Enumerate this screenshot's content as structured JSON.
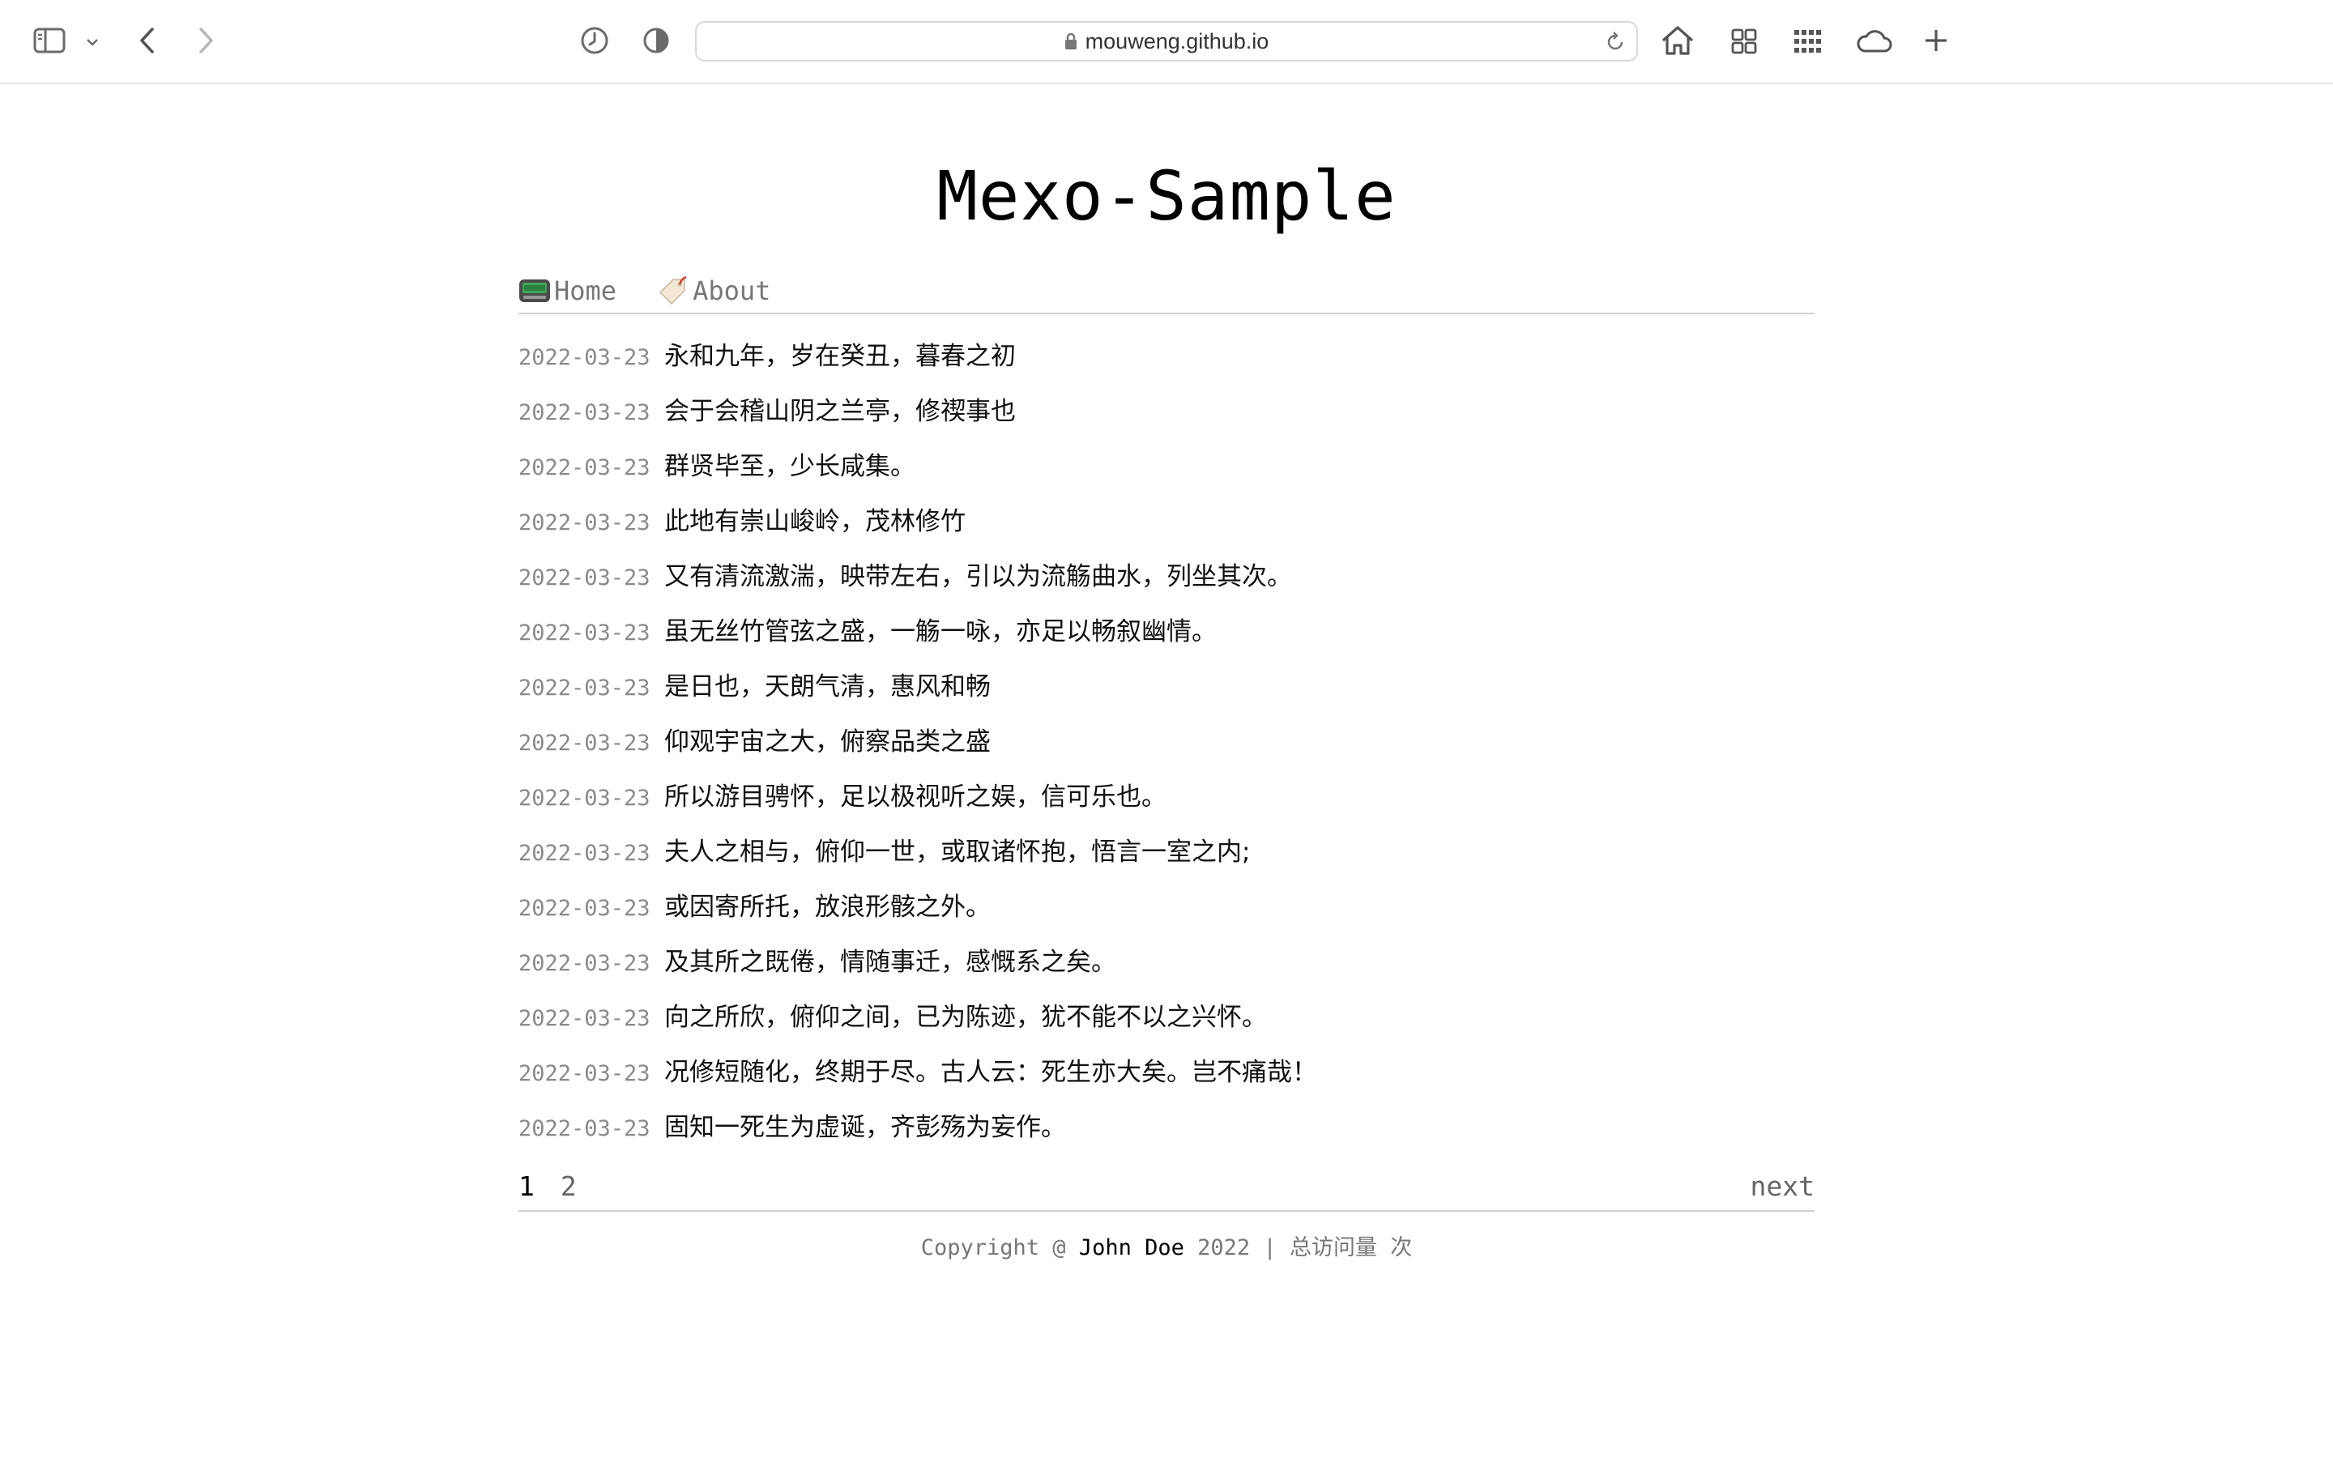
{
  "browser": {
    "url": "mouweng.github.io",
    "icons": [
      "sidebar-icon",
      "chevron-down-icon",
      "back-icon",
      "forward-icon",
      "history-icon",
      "privacy-shield-icon",
      "lock-icon",
      "reload-icon",
      "home-icon",
      "tab-overview-icon",
      "grid-icon",
      "cloud-icon",
      "plus-icon"
    ]
  },
  "site": {
    "title": "Mexo-Sample"
  },
  "nav": [
    {
      "label": "Home",
      "icon": "pager-icon"
    },
    {
      "label": "About",
      "icon": "tag-icon"
    }
  ],
  "posts": [
    {
      "date": "2022-03-23",
      "title": "永和九年，岁在癸丑，暮春之初"
    },
    {
      "date": "2022-03-23",
      "title": "会于会稽山阴之兰亭，修禊事也"
    },
    {
      "date": "2022-03-23",
      "title": "群贤毕至，少长咸集。"
    },
    {
      "date": "2022-03-23",
      "title": "此地有崇山峻岭，茂林修竹"
    },
    {
      "date": "2022-03-23",
      "title": "又有清流激湍，映带左右，引以为流觞曲水，列坐其次。"
    },
    {
      "date": "2022-03-23",
      "title": "虽无丝竹管弦之盛，一觞一咏，亦足以畅叙幽情。"
    },
    {
      "date": "2022-03-23",
      "title": "是日也，天朗气清，惠风和畅"
    },
    {
      "date": "2022-03-23",
      "title": "仰观宇宙之大，俯察品类之盛"
    },
    {
      "date": "2022-03-23",
      "title": "所以游目骋怀，足以极视听之娱，信可乐也。"
    },
    {
      "date": "2022-03-23",
      "title": "夫人之相与，俯仰一世，或取诸怀抱，悟言一室之内;"
    },
    {
      "date": "2022-03-23",
      "title": "或因寄所托，放浪形骸之外。"
    },
    {
      "date": "2022-03-23",
      "title": "及其所之既倦，情随事迁，感慨系之矣。"
    },
    {
      "date": "2022-03-23",
      "title": "向之所欣，俯仰之间，已为陈迹，犹不能不以之兴怀。"
    },
    {
      "date": "2022-03-23",
      "title": "况修短随化，终期于尽。古人云：死生亦大矣。岂不痛哉！"
    },
    {
      "date": "2022-03-23",
      "title": "固知一死生为虚诞，齐彭殇为妄作。"
    }
  ],
  "pagination": {
    "pages": [
      "1",
      "2"
    ],
    "current": "1",
    "next_label": "next"
  },
  "footer": {
    "prefix": "Copyright @",
    "author": "John Doe",
    "year": "2022",
    "separator": "|",
    "visits_label": "总访问量",
    "visits_count": "",
    "visits_suffix": "次"
  }
}
